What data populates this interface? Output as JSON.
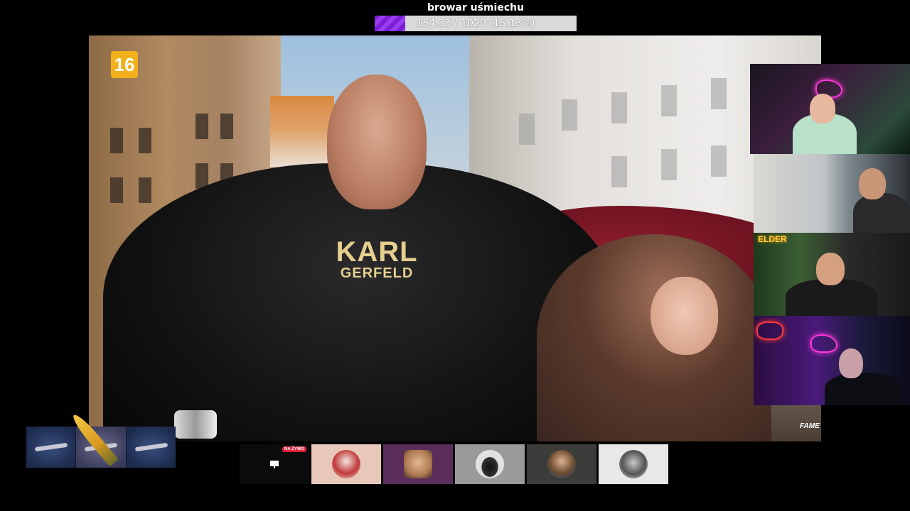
{
  "goal": {
    "title": "browar uśmiechu",
    "progress_text": "154.33 / 1020 (15.13%)",
    "progress_fraction": 0.1513
  },
  "video": {
    "age_rating": "16",
    "shirt_line1": "KARL",
    "shirt_line2": "GERFELD",
    "corner_logo": "FAME"
  },
  "cam3": {
    "sign_text": "ELDER"
  },
  "tabs": {
    "live_badge": "NA ŻYWO"
  },
  "colors": {
    "progress_fill": "#7a1fd6",
    "live_badge": "#e0213a",
    "age_badge": "#f2b01c"
  }
}
